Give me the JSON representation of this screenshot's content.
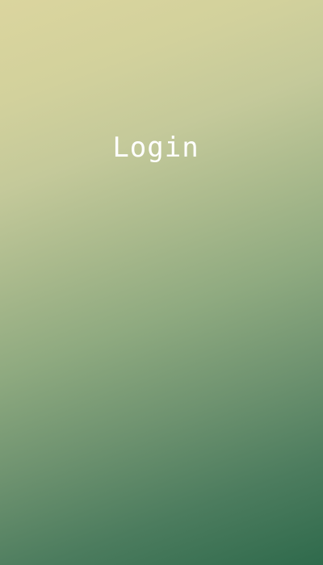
{
  "screen": {
    "title": "Login",
    "background_colors": [
      "#dbd59e",
      "#a9b98c",
      "#2f6a4c"
    ],
    "title_color": "#ffffff"
  }
}
